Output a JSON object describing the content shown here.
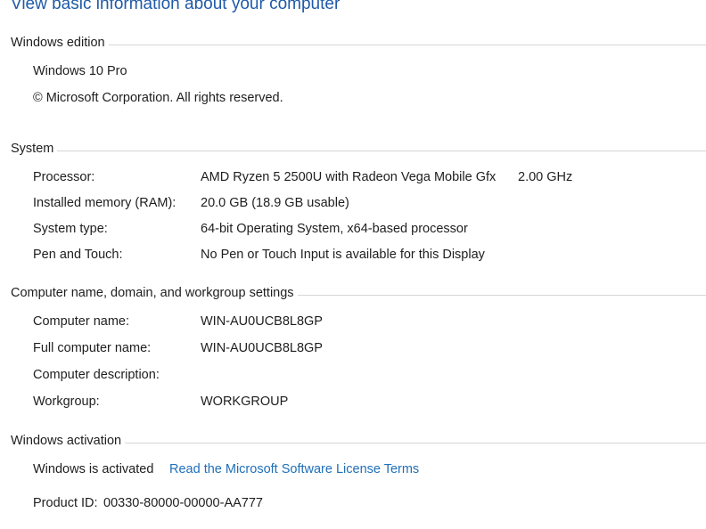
{
  "heading": "View basic information about your computer",
  "edition": {
    "title": "Windows edition",
    "name": "Windows 10 Pro",
    "copyright": "© Microsoft Corporation. All rights reserved."
  },
  "system": {
    "title": "System",
    "processor_label": "Processor:",
    "processor_value": "AMD Ryzen 5 2500U with Radeon Vega Mobile Gfx",
    "processor_speed": "2.00 GHz",
    "ram_label": "Installed memory (RAM):",
    "ram_value": "20.0 GB (18.9 GB usable)",
    "type_label": "System type:",
    "type_value": "64-bit Operating System, x64-based processor",
    "pen_label": "Pen and Touch:",
    "pen_value": "No Pen or Touch Input is available for this Display"
  },
  "computer": {
    "title": "Computer name, domain, and workgroup settings",
    "name_label": "Computer name:",
    "name_value": "WIN-AU0UCB8L8GP",
    "full_label": "Full computer name:",
    "full_value": "WIN-AU0UCB8L8GP",
    "desc_label": "Computer description:",
    "desc_value": "",
    "workgroup_label": "Workgroup:",
    "workgroup_value": "WORKGROUP"
  },
  "activation": {
    "title": "Windows activation",
    "status": "Windows is activated",
    "license_link": "Read the Microsoft Software License Terms",
    "product_id_label": "Product ID:",
    "product_id_value": "00330-80000-00000-AA777"
  }
}
